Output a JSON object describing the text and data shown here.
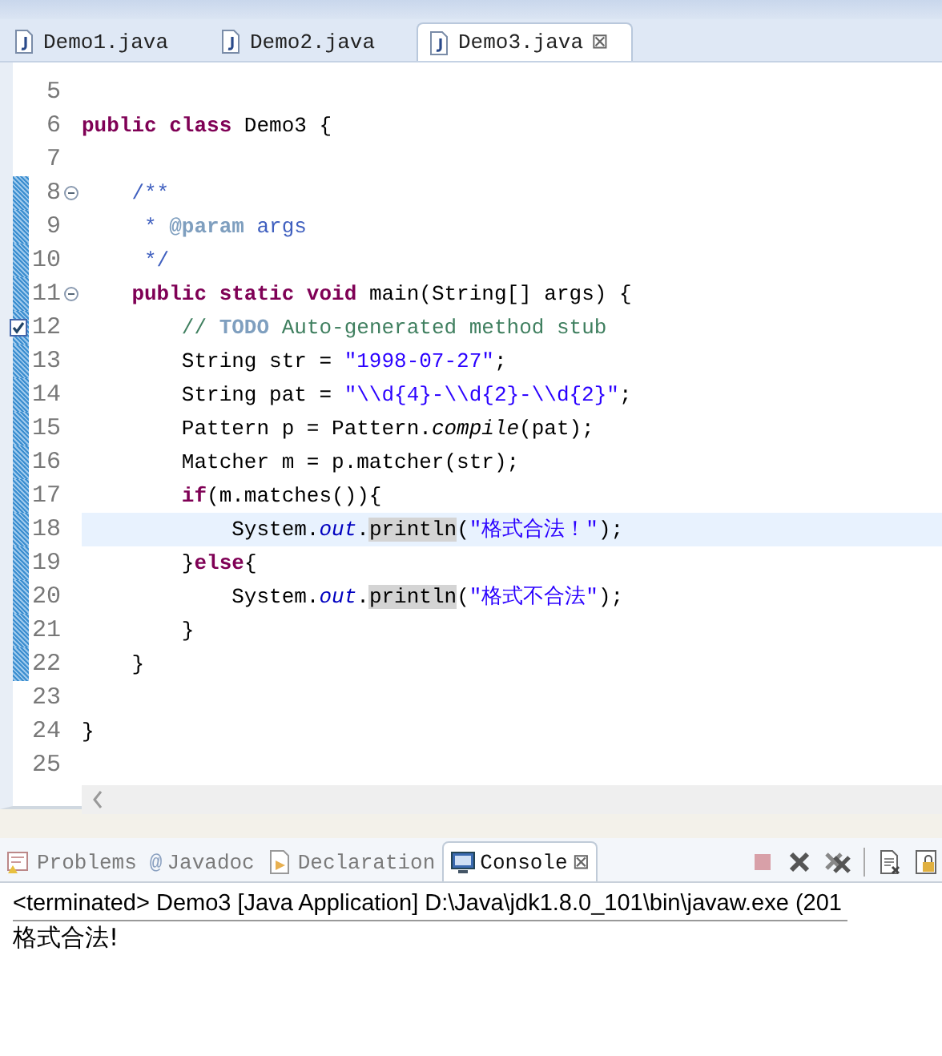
{
  "editor_tabs": [
    {
      "label": "Demo1.java",
      "selected": false
    },
    {
      "label": "Demo2.java",
      "selected": false
    },
    {
      "label": "Demo3.java",
      "selected": true,
      "close": "⊠"
    }
  ],
  "code_lines": [
    {
      "number": "5"
    },
    {
      "number": "6",
      "tokens": [
        {
          "kind": "kw",
          "text": "public"
        },
        {
          "kind": "kw",
          "text": " class"
        },
        {
          "kind": "plain",
          "text": " Demo3 {"
        }
      ]
    },
    {
      "number": "7"
    },
    {
      "number": "8",
      "fold": true,
      "changed": true,
      "tokens": [
        {
          "kind": "javadoc",
          "text": "    /**"
        }
      ]
    },
    {
      "number": "9",
      "changed": true,
      "tokens": [
        {
          "kind": "javadoc",
          "text": "     * "
        },
        {
          "kind": "tag",
          "text": "@param"
        },
        {
          "kind": "javadoc",
          "text": " args"
        }
      ]
    },
    {
      "number": "10",
      "changed": true,
      "tokens": [
        {
          "kind": "javadoc",
          "text": "     */"
        }
      ]
    },
    {
      "number": "11",
      "fold": true,
      "changed": true,
      "tokens": [
        {
          "kind": "kw",
          "text": "    public"
        },
        {
          "kind": "kw",
          "text": " static"
        },
        {
          "kind": "kw",
          "text": " void"
        },
        {
          "kind": "plain",
          "text": " main(String[] args) {"
        }
      ]
    },
    {
      "number": "12",
      "task": true,
      "changed": true,
      "tokens": [
        {
          "kind": "comment",
          "text": "        // "
        },
        {
          "kind": "todo",
          "text": "TODO"
        },
        {
          "kind": "comment",
          "text": " Auto-generated method stub"
        }
      ]
    },
    {
      "number": "13",
      "changed": true,
      "tokens": [
        {
          "kind": "plain",
          "text": "        String str = "
        },
        {
          "kind": "str",
          "text": "\"1998-07-27\""
        },
        {
          "kind": "plain",
          "text": ";"
        }
      ]
    },
    {
      "number": "14",
      "changed": true,
      "tokens": [
        {
          "kind": "plain",
          "text": "        String pat = "
        },
        {
          "kind": "str",
          "text": "\"\\\\d{4}-\\\\d{2}-\\\\d{2}\""
        },
        {
          "kind": "plain",
          "text": ";"
        }
      ]
    },
    {
      "number": "15",
      "changed": true,
      "tokens": [
        {
          "kind": "plain",
          "text": "        Pattern p = Pattern."
        },
        {
          "kind": "static",
          "text": "compile"
        },
        {
          "kind": "plain",
          "text": "(pat);"
        }
      ]
    },
    {
      "number": "16",
      "changed": true,
      "tokens": [
        {
          "kind": "plain",
          "text": "        Matcher m = p.matcher(str);"
        }
      ]
    },
    {
      "number": "17",
      "changed": true,
      "tokens": [
        {
          "kind": "kw",
          "text": "        if"
        },
        {
          "kind": "plain",
          "text": "(m.matches()){"
        }
      ]
    },
    {
      "number": "18",
      "changed": true,
      "current": true,
      "tokens": [
        {
          "kind": "plain",
          "text": "            System."
        },
        {
          "kind": "field",
          "text": "out"
        },
        {
          "kind": "plain",
          "text": "."
        },
        {
          "kind": "occurrence",
          "text": "println"
        },
        {
          "kind": "plain",
          "text": "("
        },
        {
          "kind": "str",
          "text": "\"格式合法！\""
        },
        {
          "kind": "plain",
          "text": ");"
        }
      ]
    },
    {
      "number": "19",
      "changed": true,
      "tokens": [
        {
          "kind": "plain",
          "text": "        }"
        },
        {
          "kind": "kw",
          "text": "else"
        },
        {
          "kind": "plain",
          "text": "{"
        }
      ]
    },
    {
      "number": "20",
      "changed": true,
      "tokens": [
        {
          "kind": "plain",
          "text": "            System."
        },
        {
          "kind": "field",
          "text": "out"
        },
        {
          "kind": "plain",
          "text": "."
        },
        {
          "kind": "occurrence",
          "text": "println"
        },
        {
          "kind": "plain",
          "text": "("
        },
        {
          "kind": "str",
          "text": "\"格式不合法\""
        },
        {
          "kind": "plain",
          "text": ");"
        }
      ]
    },
    {
      "number": "21",
      "changed": true,
      "tokens": [
        {
          "kind": "plain",
          "text": "        }"
        }
      ]
    },
    {
      "number": "22",
      "changed": true,
      "tokens": [
        {
          "kind": "plain",
          "text": "    }"
        }
      ]
    },
    {
      "number": "23"
    },
    {
      "number": "24",
      "tokens": [
        {
          "kind": "plain",
          "text": "}"
        }
      ]
    },
    {
      "number": "25"
    }
  ],
  "view_tabs": [
    {
      "label": "Problems",
      "kind": "problems",
      "selected": false
    },
    {
      "label": "Javadoc",
      "kind": "javadoc",
      "selected": false,
      "icon_text": "@"
    },
    {
      "label": "Declaration",
      "kind": "declaration",
      "selected": false
    },
    {
      "label": "Console",
      "kind": "console",
      "selected": true,
      "close": "⊠"
    }
  ],
  "console": {
    "header": "<terminated> Demo3 [Java Application] D:\\Java\\jdk1.8.0_101\\bin\\javaw.exe (201",
    "output": "格式合法!"
  }
}
